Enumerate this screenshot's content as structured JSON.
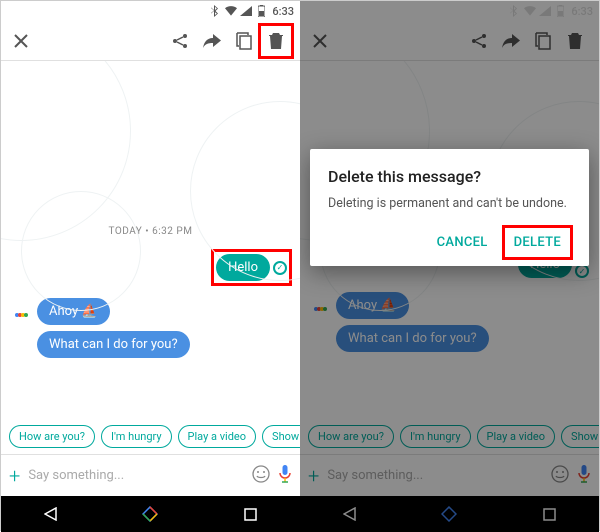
{
  "status": {
    "time": "6:33"
  },
  "chat": {
    "dateSep": "TODAY • 6:32 PM",
    "userMsg": "Hello",
    "botMsg1": "Ahoy ⛵",
    "botMsg2": "What can I do for you?"
  },
  "suggestions": [
    "How are you?",
    "I'm hungry",
    "Play a video",
    "Show me m"
  ],
  "composer": {
    "placeholder": "Say something..."
  },
  "dialog": {
    "title": "Delete this message?",
    "body": "Deleting is permanent and can't be undone.",
    "cancel": "CANCEL",
    "delete": "DELETE"
  }
}
